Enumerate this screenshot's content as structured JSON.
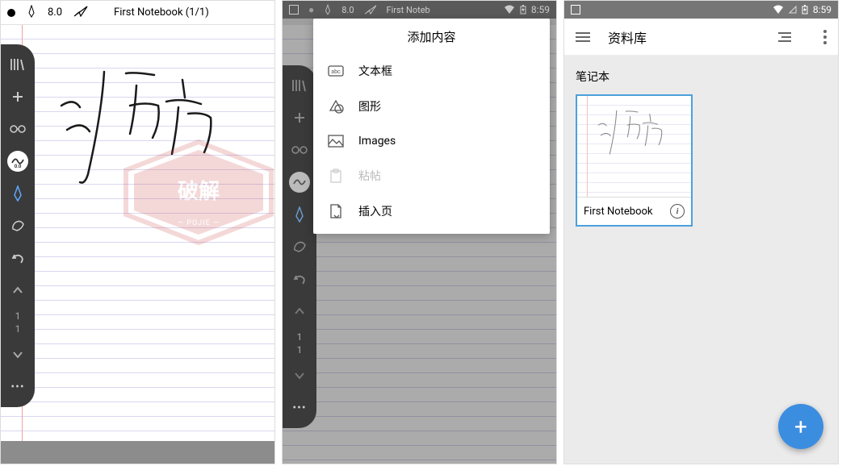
{
  "screen1": {
    "zoom": "8.0",
    "title": "First Notebook (1/1)",
    "page_current": "1",
    "page_total": "1",
    "brush_label": "0.0"
  },
  "screen2": {
    "status_time": "8:59",
    "popup_title": "添加内容",
    "items": [
      {
        "label": "文本框"
      },
      {
        "label": "图形"
      },
      {
        "label": "Images"
      },
      {
        "label": "粘帖"
      },
      {
        "label": "插入页"
      }
    ],
    "page_current": "1",
    "page_total": "1"
  },
  "screen3": {
    "status_time": "8:59",
    "header_title": "资料库",
    "section_title": "笔记本",
    "notebook_name": "First Notebook"
  }
}
